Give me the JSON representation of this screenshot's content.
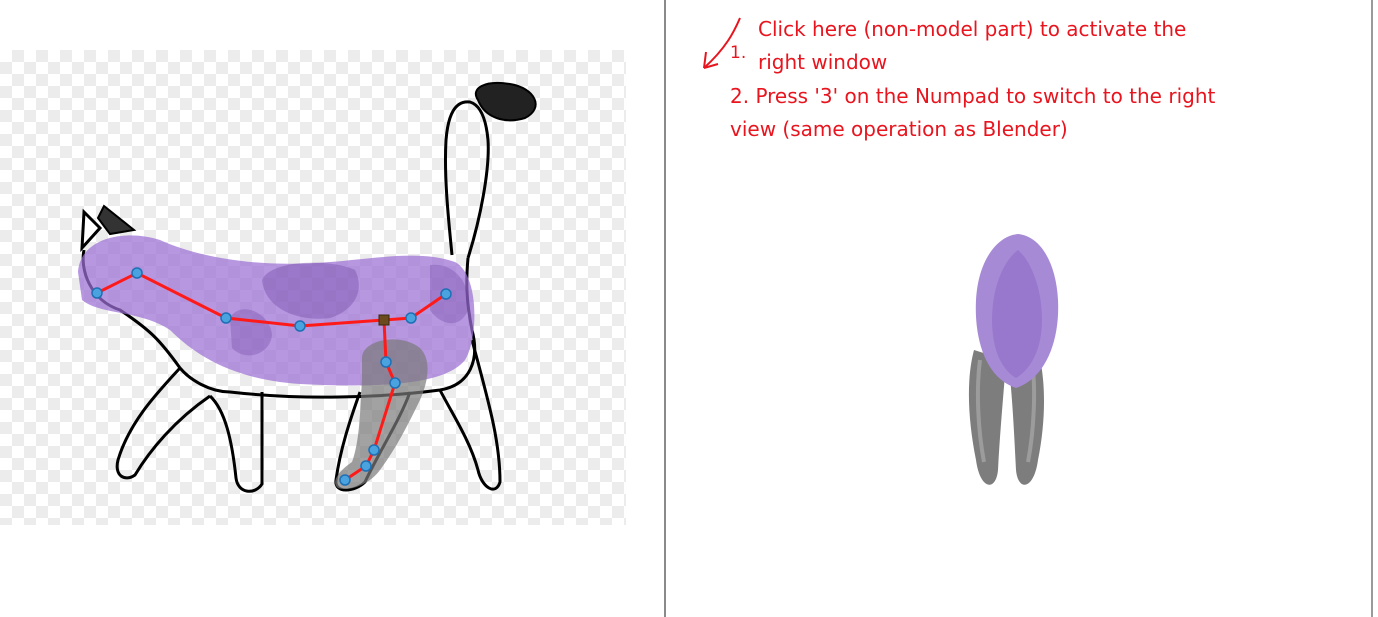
{
  "instructions": {
    "step1_number": "1.",
    "step1_line1": "Click here (non-model part) to activate the",
    "step1_line2": "right window",
    "step2_line1": "2. Press '3' on the Numpad to switch to the right",
    "step2_line2": "view (same operation as Blender)",
    "text_color": "#e8141e"
  },
  "colors": {
    "body_mesh": "#9b6fd4",
    "leg_mesh": "#8a8a8a",
    "bone": "#ff0000",
    "joint": "#4aa3df",
    "root_joint": "#6b4a1e",
    "outline": "#000000"
  }
}
